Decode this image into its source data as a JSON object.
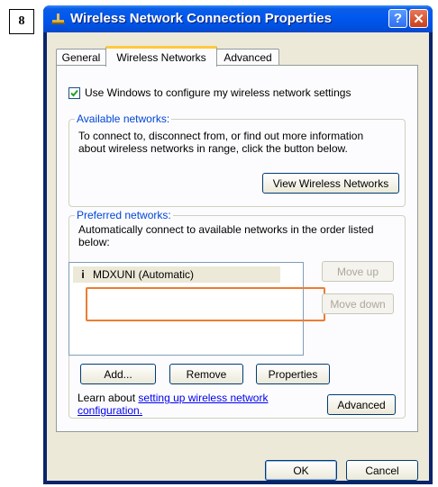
{
  "step_badge": "8",
  "window": {
    "title": "Wireless Network Connection Properties",
    "help_label": "?",
    "close_label": "✕"
  },
  "tabs": [
    {
      "label": "General"
    },
    {
      "label": "Wireless Networks"
    },
    {
      "label": "Advanced"
    }
  ],
  "use_windows_checkbox": {
    "label": "Use Windows to configure my wireless network settings",
    "checked": true
  },
  "available_networks": {
    "title": "Available networks:",
    "description_line1": "To connect to, disconnect from, or find out more information",
    "description_line2": "about wireless networks in range, click the button below.",
    "view_button": "View Wireless Networks"
  },
  "preferred_networks": {
    "title": "Preferred networks:",
    "description_line1": "Automatically connect to available networks in the order listed",
    "description_line2": "below:",
    "items": [
      {
        "label": "MDXUNI (Automatic)",
        "icon": "antenna-icon"
      }
    ],
    "move_up_button": "Move up",
    "move_down_button": "Move down",
    "add_button": "Add...",
    "remove_button": "Remove",
    "properties_button": "Properties"
  },
  "learn_about": {
    "prefix": "Learn about ",
    "link_line1": "setting up wireless network",
    "link_line2": "configuration.",
    "advanced_button": "Advanced"
  },
  "footer": {
    "ok_button": "OK",
    "cancel_button": "Cancel"
  },
  "colors": {
    "titlebar": "#0058ee",
    "callout_border": "#ed7d31",
    "group_title": "#0046d5",
    "link": "#0000ee"
  }
}
